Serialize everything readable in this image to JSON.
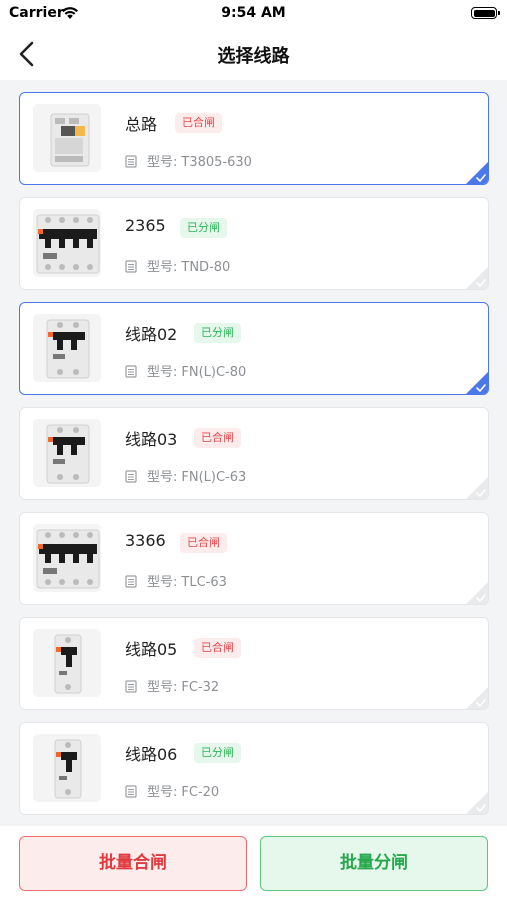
{
  "status_bar": {
    "carrier": "Carrier",
    "time": "9:54 AM"
  },
  "nav": {
    "title": "选择线路"
  },
  "model_label": "型号:",
  "lines": [
    {
      "name": "总路",
      "status": "已合闸",
      "status_type": "closed",
      "model": "T3805-630",
      "selected": true,
      "image": "breaker-3pole-tall"
    },
    {
      "name": "2365",
      "status": "已分闸",
      "status_type": "open",
      "model": "TND-80",
      "selected": false,
      "image": "breaker-4pole"
    },
    {
      "name": "线路02",
      "status": "已分闸",
      "status_type": "open",
      "model": "FN(L)C-80",
      "selected": true,
      "image": "breaker-2pole"
    },
    {
      "name": "线路03",
      "status": "已合闸",
      "status_type": "closed",
      "model": "FN(L)C-63",
      "selected": false,
      "image": "breaker-2pole"
    },
    {
      "name": "3366",
      "status": "已合闸",
      "status_type": "closed",
      "model": "TLC-63",
      "selected": false,
      "image": "breaker-4pole"
    },
    {
      "name": "线路05",
      "status": "已合闸",
      "status_type": "closed",
      "model": "FC-32",
      "selected": false,
      "image": "breaker-1pole"
    },
    {
      "name": "线路06",
      "status": "已分闸",
      "status_type": "open",
      "model": "FC-20",
      "selected": false,
      "image": "breaker-1pole"
    }
  ],
  "colors": {
    "accent": "#4b77e8",
    "closed": "#e5484d",
    "open": "#2fb55a"
  },
  "footer": {
    "batch_close": "批量合闸",
    "batch_open": "批量分闸"
  }
}
